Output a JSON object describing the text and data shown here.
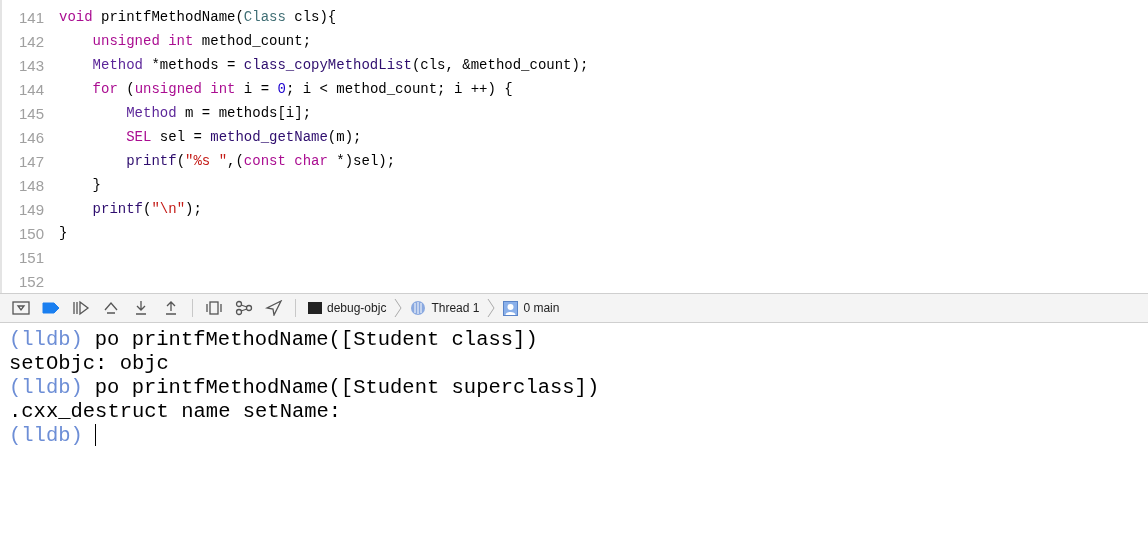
{
  "editor": {
    "lines": [
      {
        "number": "141",
        "tokens": [
          {
            "text": "void",
            "kind": "keyword"
          },
          {
            "text": " printfMethodName(",
            "kind": "plain"
          },
          {
            "text": "Class",
            "kind": "class"
          },
          {
            "text": " cls){",
            "kind": "plain"
          }
        ]
      },
      {
        "number": "142",
        "tokens": [
          {
            "text": "    unsigned int",
            "kind": "keyword"
          },
          {
            "text": " method_count;",
            "kind": "plain"
          }
        ]
      },
      {
        "number": "143",
        "tokens": [
          {
            "text": "    Method",
            "kind": "type"
          },
          {
            "text": " *methods = ",
            "kind": "plain"
          },
          {
            "text": "class_copyMethodList",
            "kind": "func"
          },
          {
            "text": "(cls, &method_count);",
            "kind": "plain"
          }
        ]
      },
      {
        "number": "144",
        "tokens": [
          {
            "text": "    for",
            "kind": "keyword"
          },
          {
            "text": " (",
            "kind": "plain"
          },
          {
            "text": "unsigned int",
            "kind": "keyword"
          },
          {
            "text": " i = ",
            "kind": "plain"
          },
          {
            "text": "0",
            "kind": "number"
          },
          {
            "text": "; i < method_count; i ++) {",
            "kind": "plain"
          }
        ]
      },
      {
        "number": "145",
        "tokens": [
          {
            "text": "        Method",
            "kind": "type"
          },
          {
            "text": " m = methods[i];",
            "kind": "plain"
          }
        ]
      },
      {
        "number": "146",
        "tokens": [
          {
            "text": "        SEL",
            "kind": "keyword"
          },
          {
            "text": " sel = ",
            "kind": "plain"
          },
          {
            "text": "method_getName",
            "kind": "func"
          },
          {
            "text": "(m);",
            "kind": "plain"
          }
        ]
      },
      {
        "number": "147",
        "tokens": [
          {
            "text": "        printf",
            "kind": "func"
          },
          {
            "text": "(",
            "kind": "plain"
          },
          {
            "text": "\"%s \"",
            "kind": "string"
          },
          {
            "text": ",(",
            "kind": "plain"
          },
          {
            "text": "const char",
            "kind": "keyword"
          },
          {
            "text": " *)sel);",
            "kind": "plain"
          }
        ]
      },
      {
        "number": "148",
        "tokens": [
          {
            "text": "    }",
            "kind": "plain"
          }
        ]
      },
      {
        "number": "149",
        "tokens": [
          {
            "text": "    printf",
            "kind": "func"
          },
          {
            "text": "(",
            "kind": "plain"
          },
          {
            "text": "\"\\n\"",
            "kind": "string"
          },
          {
            "text": ");",
            "kind": "plain"
          }
        ]
      },
      {
        "number": "150",
        "tokens": [
          {
            "text": "}",
            "kind": "plain"
          }
        ]
      },
      {
        "number": "151"
      },
      {
        "number": "152"
      }
    ]
  },
  "debug_bar": {
    "breakpoints_active": true,
    "breadcrumbs": [
      {
        "kind": "process",
        "label": "debug-objc"
      },
      {
        "kind": "thread",
        "label": "Thread 1"
      },
      {
        "kind": "frame",
        "label": "0 main"
      }
    ]
  },
  "console": {
    "lines": [
      {
        "kind": "command",
        "prompt": "(lldb)",
        "text": "po printfMethodName([Student class])"
      },
      {
        "kind": "output",
        "text": "setObjc: objc"
      },
      {
        "kind": "command",
        "prompt": "(lldb)",
        "text": "po printfMethodName([Student superclass])"
      },
      {
        "kind": "output",
        "text": ".cxx_destruct name setName:"
      },
      {
        "kind": "prompt",
        "prompt": "(lldb)"
      }
    ]
  }
}
